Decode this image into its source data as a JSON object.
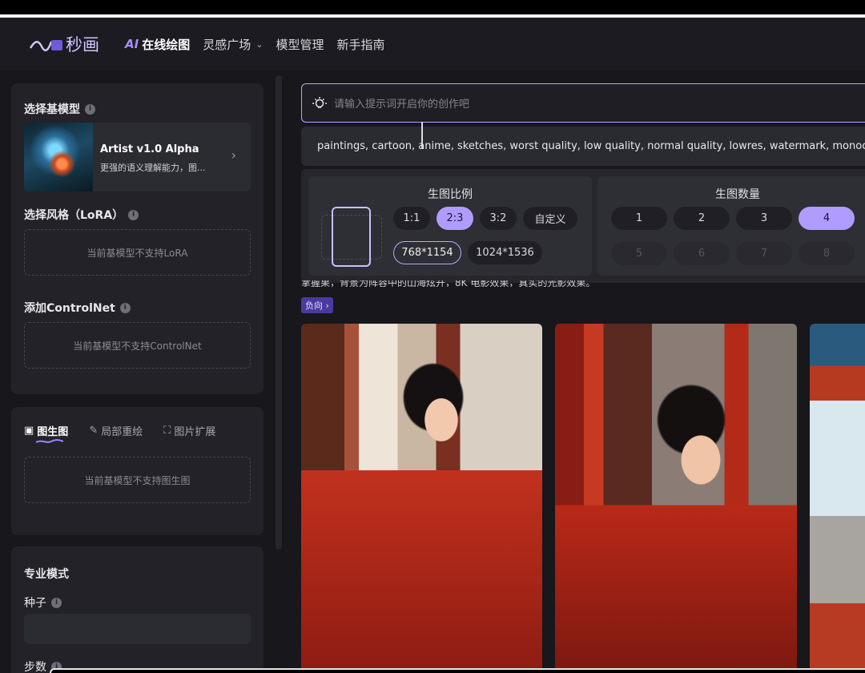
{
  "header": {
    "logo_text": "秒画",
    "nav": [
      {
        "prefix": "AI",
        "label": "在线绘图"
      },
      {
        "label": "灵感广场",
        "chevron": "⌄"
      },
      {
        "label": "模型管理"
      },
      {
        "label": "新手指南"
      }
    ]
  },
  "sidebar": {
    "base_model": {
      "title": "选择基模型",
      "name": "Artist v1.0 Alpha",
      "desc": "更强的语义理解能力，图..."
    },
    "lora": {
      "title": "选择风格（LoRA）",
      "empty": "当前基模型不支持LoRA"
    },
    "controlnet": {
      "title": "添加ControlNet",
      "empty": "当前基模型不支持ControlNet"
    },
    "img_tabs": [
      {
        "icon": "image-icon",
        "label": "图生图"
      },
      {
        "icon": "brush-icon",
        "label": "局部重绘"
      },
      {
        "icon": "expand-icon",
        "label": "图片扩展"
      }
    ],
    "img_empty": "当前基模型不支持图生图",
    "pro": {
      "title": "专业模式",
      "seed_label": "种子",
      "steps_label": "步数"
    }
  },
  "main": {
    "prompt_placeholder": "请输入提示词开启你的创作吧",
    "negative_prompt": "paintings, cartoon, anime, sketches, worst quality, low quality, normal quality, lowres, watermark, monochrome",
    "ratio": {
      "title": "生图比例",
      "options": [
        "1:1",
        "2:3",
        "3:2",
        "自定义"
      ],
      "selected": "2:3",
      "sizes": [
        "768*1154",
        "1024*1536"
      ],
      "selected_size": "768*1154"
    },
    "count": {
      "title": "生图数量",
      "options": [
        "1",
        "2",
        "3",
        "4"
      ],
      "selected": "4",
      "disabled_options": [
        "5",
        "6",
        "7",
        "8"
      ]
    },
    "clipped_prompt": "掌握果，背景为阵容中的山海炫开，8K 电影效果，真实的光影效果。",
    "negative_tag": "负向 ›",
    "photo_label": ""
  },
  "colors": {
    "accent": "#b09cff",
    "accent_border": "#b5a8ff",
    "bg": "#17171c",
    "panel": "#222228"
  }
}
